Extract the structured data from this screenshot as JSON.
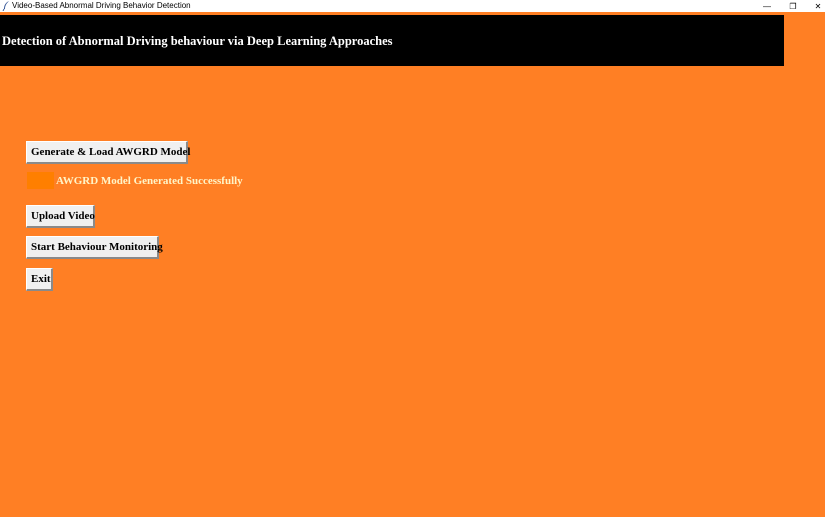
{
  "window": {
    "title": "Video-Based Abnormal Driving Behavior Detection",
    "controls": {
      "minimize": "—",
      "maximize": "❐",
      "close": "✕"
    }
  },
  "header": {
    "heading": "Detection of Abnormal Driving behaviour via Deep Learning Approaches"
  },
  "actions": {
    "generate_label": "Generate & Load AWGRD Model",
    "upload_label": "Upload Video",
    "monitor_label": "Start Behaviour Monitoring",
    "exit_label": "Exit"
  },
  "status": {
    "message": "AWGRD Model Generated Successfully"
  },
  "colors": {
    "background": "#FF7F24",
    "header_background": "#000000",
    "button_face": "#F0F0F0",
    "status_swatch": "#FF7F00",
    "status_text": "#FFF5C8"
  },
  "icons": {
    "app": "feather-icon"
  }
}
